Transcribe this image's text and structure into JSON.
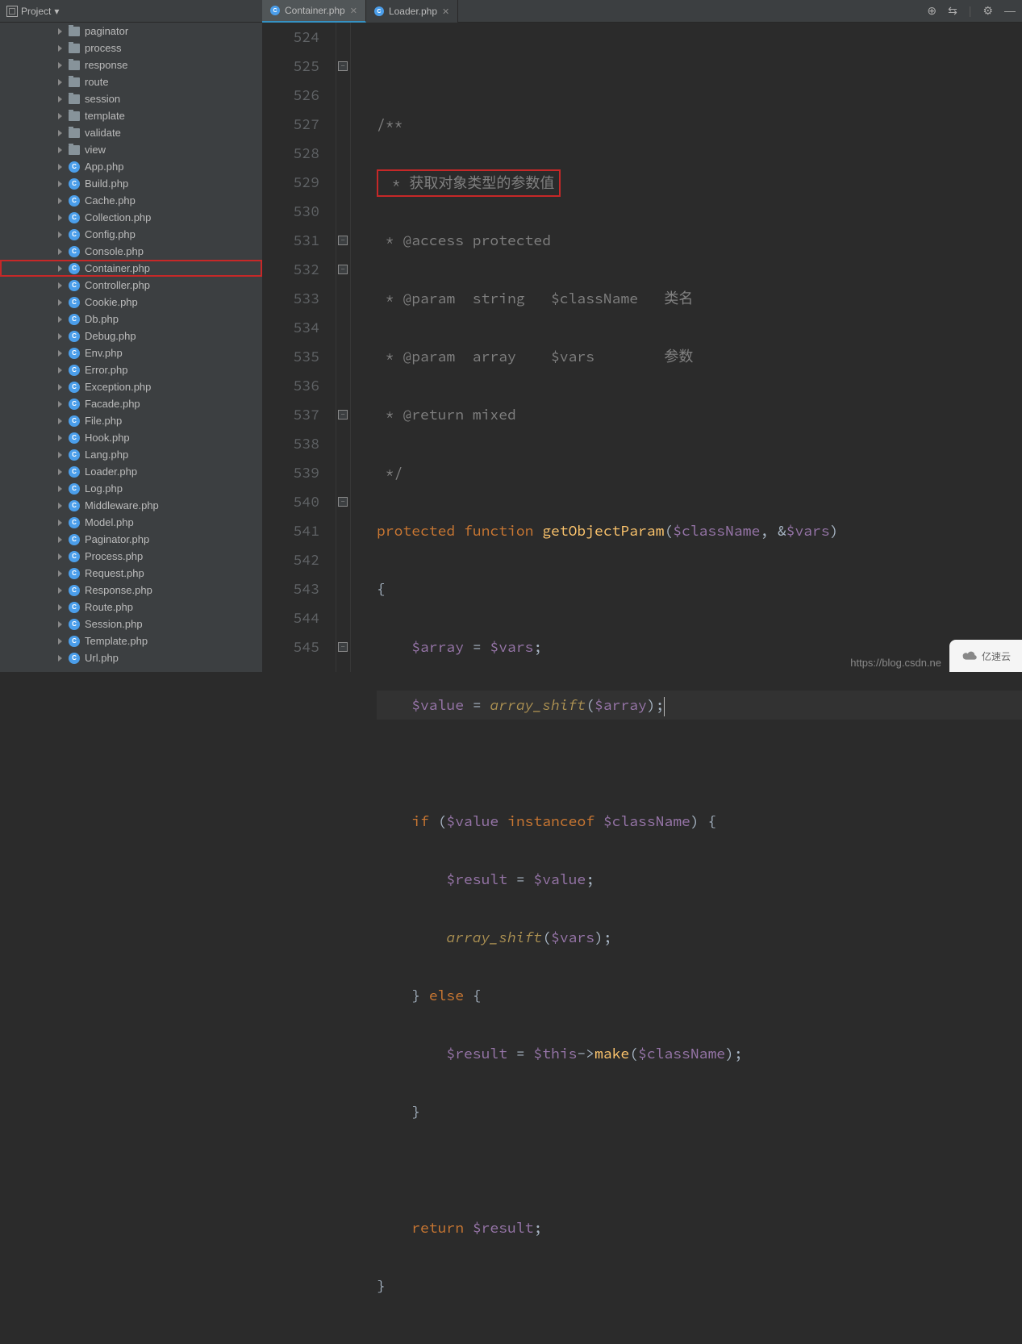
{
  "toolbar": {
    "project_label": "Project"
  },
  "tabs": [
    {
      "label": "Container.php",
      "active": true
    },
    {
      "label": "Loader.php",
      "active": false
    }
  ],
  "sidebar": {
    "folders": [
      {
        "name": "paginator"
      },
      {
        "name": "process"
      },
      {
        "name": "response"
      },
      {
        "name": "route"
      },
      {
        "name": "session"
      },
      {
        "name": "template"
      },
      {
        "name": "validate"
      },
      {
        "name": "view"
      }
    ],
    "files": [
      {
        "name": "App.php"
      },
      {
        "name": "Build.php"
      },
      {
        "name": "Cache.php"
      },
      {
        "name": "Collection.php"
      },
      {
        "name": "Config.php"
      },
      {
        "name": "Console.php"
      },
      {
        "name": "Container.php",
        "selected": true
      },
      {
        "name": "Controller.php"
      },
      {
        "name": "Cookie.php"
      },
      {
        "name": "Db.php"
      },
      {
        "name": "Debug.php"
      },
      {
        "name": "Env.php"
      },
      {
        "name": "Error.php"
      },
      {
        "name": "Exception.php"
      },
      {
        "name": "Facade.php"
      },
      {
        "name": "File.php"
      },
      {
        "name": "Hook.php"
      },
      {
        "name": "Lang.php"
      },
      {
        "name": "Loader.php"
      },
      {
        "name": "Log.php"
      },
      {
        "name": "Middleware.php"
      },
      {
        "name": "Model.php"
      },
      {
        "name": "Paginator.php"
      },
      {
        "name": "Process.php"
      },
      {
        "name": "Request.php"
      },
      {
        "name": "Response.php"
      },
      {
        "name": "Route.php"
      },
      {
        "name": "Session.php"
      },
      {
        "name": "Template.php"
      },
      {
        "name": "Url.php"
      }
    ]
  },
  "editor": {
    "line_start": 524,
    "line_end": 545,
    "current_line": 535,
    "comment_open": "/**",
    "comment_line1": " * 获取对象类型的参数值",
    "comment_line2": " * @access protected",
    "comment_line3": " * @param  string   $className   类名",
    "comment_line4": " * @param  array    $vars        参数",
    "comment_line5": " * @return mixed",
    "comment_close": " */",
    "kw_protected": "protected",
    "kw_function": "function",
    "fn_name": "getObjectParam",
    "var_className": "$className",
    "var_vars": "$vars",
    "var_array": "$array",
    "var_value": "$value",
    "var_result": "$result",
    "var_this": "$this",
    "kw_if": "if",
    "kw_else": "else",
    "kw_instanceof": "instanceof",
    "kw_return": "return",
    "fn_array_shift": "array_shift",
    "fn_make": "make"
  },
  "watermark": {
    "url": "https://blog.csdn.ne",
    "logo_text": "亿速云"
  }
}
